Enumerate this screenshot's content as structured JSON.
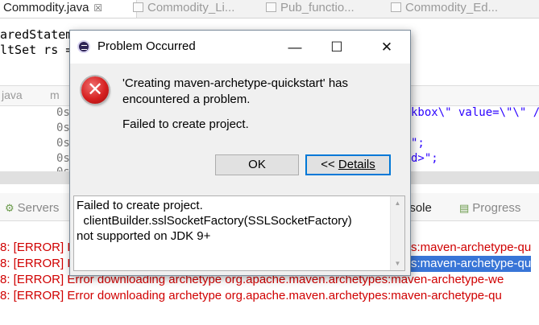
{
  "editor_tabs": [
    {
      "label": "Commodity.java",
      "close": "☒",
      "active": true
    },
    {
      "label": "Commodity_Li...",
      "close": "",
      "active": false
    },
    {
      "label": "Pub_functio...",
      "close": "",
      "active": false
    },
    {
      "label": "Commodity_Ed...",
      "close": "",
      "active": false
    }
  ],
  "code_lines": [
    "aredStatem",
    "ltSet rs ="
  ],
  "mid_tabs": [
    "java",
    "m"
  ],
  "code2_lines": [
    {
      "prefix": "0s",
      "rest": "kbox\\\" value=\\\"\\\" />"
    },
    {
      "prefix": "0s",
      "rest": ""
    },
    {
      "prefix": "0s",
      "rest": "\";"
    },
    {
      "prefix": "0s",
      "rest": "d>\";"
    },
    {
      "prefix": "0s",
      "rest": "d>\""
    }
  ],
  "bottom_tabs": [
    {
      "label": "Servers",
      "icon": "servers-icon"
    },
    {
      "label": "nsole",
      "icon": "console-icon"
    },
    {
      "label": "Progress",
      "icon": "progress-icon"
    }
  ],
  "console_lines": [
    {
      "left": "8: [ERROR] E",
      "sel": "",
      "right": "s:maven-archetype-qu"
    },
    {
      "left": "8: [ERROR] E",
      "sel": "E",
      "right": "s:maven-archetype-qu"
    },
    {
      "left": "8: [ERROR] Error downloading archetype org.apache.maven.archetypes:maven-archetype-we",
      "sel": "",
      "right": ""
    },
    {
      "left": "8: [ERROR] Error downloading archetype org.apache.maven.archetypes:maven-archetype-qu",
      "sel": "",
      "right": ""
    }
  ],
  "dialog": {
    "title": "Problem Occurred",
    "minimize": "—",
    "maximize": "☐",
    "close": "✕",
    "error_glyph": "✕",
    "message": "'Creating maven-archetype-quickstart' has encountered a problem.",
    "sub_message": "Failed to create project.",
    "ok_label": "OK",
    "details_prefix": "<< ",
    "details_label": "Details",
    "details_text": "Failed to create project.\n  clientBuilder.sslSocketFactory(SSLSocketFactory)\nnot supported on JDK 9+",
    "scroll_up": "▲",
    "scroll_down": "▼"
  }
}
